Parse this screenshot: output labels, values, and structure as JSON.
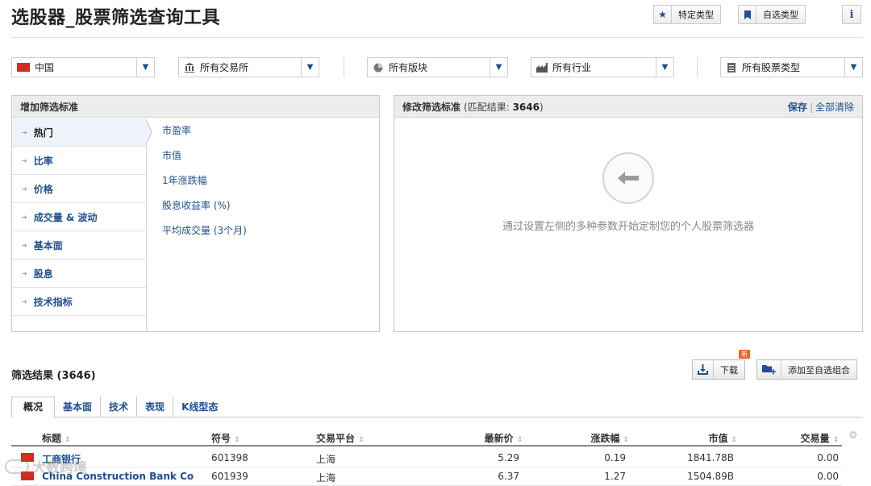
{
  "page_title": "选股器_股票筛选查询工具",
  "toolbar": {
    "specific_type_label": "特定类型",
    "custom_type_label": "自选类型",
    "info_label": "i"
  },
  "filters": {
    "country": "中国",
    "exchange": "所有交易所",
    "sector": "所有版块",
    "industry": "所有行业",
    "stock_type": "所有股票类型"
  },
  "add_criteria": {
    "header": "增加筛选标准",
    "categories": [
      {
        "label": "热门",
        "active": true
      },
      {
        "label": "比率",
        "active": false
      },
      {
        "label": "价格",
        "active": false
      },
      {
        "label": "成交量 & 波动",
        "active": false
      },
      {
        "label": "基本面",
        "active": false
      },
      {
        "label": "股息",
        "active": false
      },
      {
        "label": "技术指标",
        "active": false
      }
    ],
    "criteria": [
      "市盈率",
      "市值",
      "1年涨跌幅",
      "股息收益率 (%)",
      "平均成交量 (3个月)"
    ]
  },
  "modify_criteria": {
    "header": "修改筛选标准",
    "match_prefix": "(匹配结果:",
    "match_count": "3646",
    "match_suffix": ")",
    "save_label": "保存",
    "separator": "|",
    "clear_label": "全部清除",
    "hint": "通过设置左侧的多种参数开始定制您的个人股票筛选器"
  },
  "results": {
    "title": "筛选结果 (3646)",
    "download_label": "下载",
    "new_badge": "新",
    "add_to_portfolio_label": "添加至自选组合",
    "tabs": [
      "概况",
      "基本面",
      "技术",
      "表现",
      "K线型态"
    ],
    "columns": [
      "标题",
      "符号",
      "交易平台",
      "最新价",
      "涨跌幅",
      "市值",
      "交易量"
    ],
    "rows": [
      {
        "name": "工商银行",
        "symbol": "601398",
        "exchange": "上海",
        "last": "5.29",
        "change": "0.19",
        "mcap": "1841.78B",
        "volume": "0.00"
      },
      {
        "name": "China Construction Bank Co",
        "symbol": "601939",
        "exchange": "上海",
        "last": "6.37",
        "change": "1.27",
        "mcap": "1504.89B",
        "volume": "0.00"
      }
    ]
  },
  "watermark": "大数跨境",
  "colors": {
    "link": "#1f4f8f",
    "flag": "#d52b1e",
    "badge": "#e8662a"
  }
}
